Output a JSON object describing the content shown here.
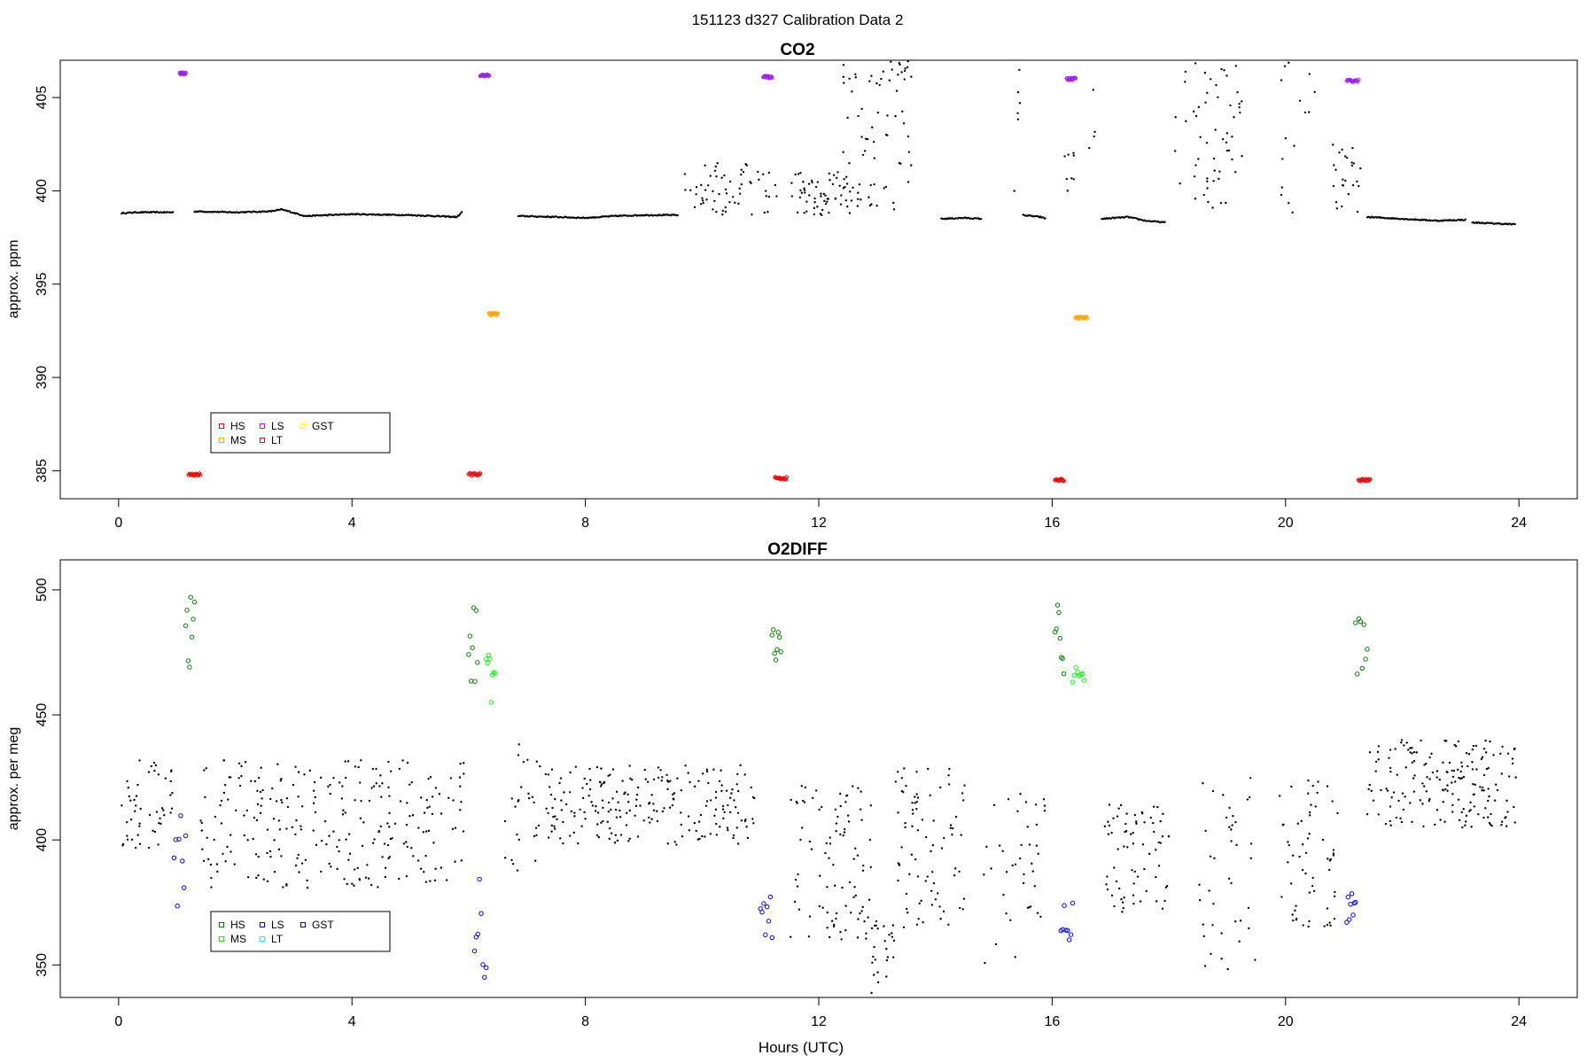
{
  "suptitle": "151123   d327   Calibration Data 2",
  "xlabel": "Hours (UTC)",
  "chart_data": [
    {
      "type": "scatter",
      "title": "CO2",
      "ylabel": "approx. ppm",
      "xlim": [
        -1,
        25
      ],
      "ylim": [
        383.5,
        407
      ],
      "xticks": [
        0,
        4,
        8,
        12,
        16,
        20,
        24
      ],
      "yticks": [
        385,
        390,
        395,
        400,
        405
      ],
      "legend": {
        "position": "bottom-left",
        "entries": [
          {
            "label": "HS",
            "color": "#ff0000"
          },
          {
            "label": "MS",
            "color": "#ffa500"
          },
          {
            "label": "LS",
            "color": "#a020f0"
          },
          {
            "label": "LT",
            "color": "#b22222"
          },
          {
            "label": "GST",
            "color": "#ffff00"
          }
        ]
      },
      "sample_series": {
        "name": "sample",
        "color": "#000000",
        "segments": [
          {
            "x": [
              0.05,
              0.3,
              0.6,
              0.95
            ],
            "y": [
              398.8,
              398.85,
              398.85,
              398.85
            ]
          },
          {
            "x": [
              1.3,
              2.0,
              2.6,
              2.8,
              3.2,
              4.0,
              5.0,
              5.8,
              5.9
            ],
            "y": [
              398.9,
              398.85,
              398.9,
              399.0,
              398.65,
              398.75,
              398.7,
              398.6,
              398.9
            ]
          },
          {
            "x": [
              6.85,
              7.5,
              8.0,
              8.5,
              9.0,
              9.6
            ],
            "y": [
              398.65,
              398.6,
              398.55,
              398.65,
              398.7,
              398.7
            ]
          },
          {
            "x": [
              14.1,
              14.5,
              14.8
            ],
            "y": [
              398.5,
              398.55,
              398.5
            ]
          },
          {
            "x": [
              15.5,
              15.8,
              15.9
            ],
            "y": [
              398.7,
              398.6,
              398.5
            ]
          },
          {
            "x": [
              16.85,
              17.3,
              17.6,
              17.95
            ],
            "y": [
              398.5,
              398.6,
              398.4,
              398.3
            ]
          },
          {
            "x": [
              21.4,
              22.0,
              22.6,
              23.1
            ],
            "y": [
              398.6,
              398.5,
              398.4,
              398.45
            ]
          },
          {
            "x": [
              23.2,
              23.6,
              23.95
            ],
            "y": [
              398.3,
              398.25,
              398.2
            ]
          }
        ],
        "scatter_clusters": [
          {
            "x": [
              9.7,
              11.3
            ],
            "y": [
              398.7,
              401.5
            ],
            "n": 60
          },
          {
            "x": [
              11.5,
              12.6
            ],
            "y": [
              398.7,
              401.0
            ],
            "n": 60
          },
          {
            "x": [
              12.4,
              13.6
            ],
            "y": [
              399.0,
              407.0
            ],
            "n": 70
          },
          {
            "x": [
              15.3,
              15.5
            ],
            "y": [
              398.5,
              406.5
            ],
            "n": 6
          },
          {
            "x": [
              16.2,
              16.4
            ],
            "y": [
              398.7,
              402.5
            ],
            "n": 8
          },
          {
            "x": [
              16.6,
              16.75
            ],
            "y": [
              402.0,
              406.0
            ],
            "n": 4
          },
          {
            "x": [
              18.0,
              18.3
            ],
            "y": [
              400.0,
              406.8
            ],
            "n": 6
          },
          {
            "x": [
              18.4,
              19.3
            ],
            "y": [
              399.0,
              406.9
            ],
            "n": 50
          },
          {
            "x": [
              19.9,
              20.5
            ],
            "y": [
              398.8,
              407.0
            ],
            "n": 15
          },
          {
            "x": [
              20.8,
              21.3
            ],
            "y": [
              398.8,
              402.8
            ],
            "n": 25
          }
        ]
      },
      "calibration_groups": [
        {
          "label": "LS",
          "color": "#a020f0",
          "x": [
            1.05,
            1.15
          ],
          "y": 406.3
        },
        {
          "label": "HS",
          "color": "#ff0000",
          "x": [
            1.2,
            1.4
          ],
          "y": 384.8
        },
        {
          "label": "HS",
          "color": "#ff0000",
          "x": [
            6.0,
            6.2
          ],
          "y": 384.8
        },
        {
          "label": "LS",
          "color": "#a020f0",
          "x": [
            6.2,
            6.35
          ],
          "y": 406.2
        },
        {
          "label": "MS",
          "color": "#ffa500",
          "x": [
            6.35,
            6.5
          ],
          "y": 393.4
        },
        {
          "label": "LS",
          "color": "#a020f0",
          "x": [
            11.05,
            11.2
          ],
          "y": 406.1
        },
        {
          "label": "HS",
          "color": "#ff0000",
          "x": [
            11.25,
            11.45
          ],
          "y": 384.6
        },
        {
          "label": "HS",
          "color": "#ff0000",
          "x": [
            16.05,
            16.2
          ],
          "y": 384.5
        },
        {
          "label": "LS",
          "color": "#a020f0",
          "x": [
            16.25,
            16.4
          ],
          "y": 406.0
        },
        {
          "label": "MS",
          "color": "#ffa500",
          "x": [
            16.4,
            16.6
          ],
          "y": 393.2
        },
        {
          "label": "LS",
          "color": "#a020f0",
          "x": [
            21.05,
            21.25
          ],
          "y": 405.9
        },
        {
          "label": "HS",
          "color": "#ff0000",
          "x": [
            21.25,
            21.45
          ],
          "y": 384.5
        }
      ]
    },
    {
      "type": "scatter",
      "title": "O2DIFF",
      "ylabel": "approx. per meg",
      "xlim": [
        -1,
        25
      ],
      "ylim": [
        337,
        512
      ],
      "xticks": [
        0,
        4,
        8,
        12,
        16,
        20,
        24
      ],
      "yticks": [
        350,
        400,
        450,
        500
      ],
      "legend": {
        "position": "bottom-left",
        "entries": [
          {
            "label": "HS",
            "color": "#008000"
          },
          {
            "label": "MS",
            "color": "#00ff00"
          },
          {
            "label": "LS",
            "color": "#0000ff"
          },
          {
            "label": "LT",
            "color": "#00ffff"
          },
          {
            "label": "GST",
            "color": "#0000cd"
          }
        ]
      },
      "sample_series": {
        "name": "sample",
        "color": "#000000",
        "scatter_clusters": [
          {
            "x": [
              0.05,
              0.95
            ],
            "y": [
              395,
              432
            ],
            "n": 50
          },
          {
            "x": [
              1.4,
              6.0
            ],
            "y": [
              380,
              432
            ],
            "n": 260
          },
          {
            "x": [
              6.6,
              7.2
            ],
            "y": [
              385,
              440
            ],
            "n": 25
          },
          {
            "x": [
              7.2,
              10.9
            ],
            "y": [
              398,
              430
            ],
            "n": 220
          },
          {
            "x": [
              11.5,
              12.9
            ],
            "y": [
              360,
              422
            ],
            "n": 90
          },
          {
            "x": [
              12.9,
              13.3
            ],
            "y": [
              338,
              370
            ],
            "n": 25
          },
          {
            "x": [
              13.3,
              14.5
            ],
            "y": [
              365,
              430
            ],
            "n": 80
          },
          {
            "x": [
              14.8,
              15.9
            ],
            "y": [
              350,
              420
            ],
            "n": 40
          },
          {
            "x": [
              16.9,
              18.0
            ],
            "y": [
              370,
              415
            ],
            "n": 70
          },
          {
            "x": [
              18.5,
              19.5
            ],
            "y": [
              345,
              425
            ],
            "n": 40
          },
          {
            "x": [
              19.9,
              20.9
            ],
            "y": [
              365,
              425
            ],
            "n": 60
          },
          {
            "x": [
              21.4,
              23.95
            ],
            "y": [
              405,
              440
            ],
            "n": 180
          }
        ]
      },
      "calibration_groups": [
        {
          "label": "LS",
          "color": "#0000ff",
          "x": [
            0.95,
            1.15
          ],
          "y": [
            370,
            410
          ]
        },
        {
          "label": "HS",
          "color": "#008000",
          "x": [
            1.15,
            1.3
          ],
          "y": [
            458,
            505
          ]
        },
        {
          "label": "HS",
          "color": "#008000",
          "x": [
            6.0,
            6.15
          ],
          "y": [
            458,
            502
          ]
        },
        {
          "label": "LS",
          "color": "#0000ff",
          "x": [
            6.1,
            6.3
          ],
          "y": [
            344,
            385
          ]
        },
        {
          "label": "MS",
          "color": "#00ff00",
          "x": [
            6.3,
            6.45
          ],
          "y": [
            455,
            483
          ]
        },
        {
          "label": "LS",
          "color": "#0000ff",
          "x": [
            11.0,
            11.2
          ],
          "y": [
            358,
            380
          ]
        },
        {
          "label": "HS",
          "color": "#008000",
          "x": [
            11.2,
            11.35
          ],
          "y": [
            471,
            490
          ]
        },
        {
          "label": "HS",
          "color": "#008000",
          "x": [
            16.05,
            16.2
          ],
          "y": [
            450,
            494
          ]
        },
        {
          "label": "LS",
          "color": "#0000ff",
          "x": [
            16.15,
            16.35
          ],
          "y": [
            358,
            375
          ]
        },
        {
          "label": "MS",
          "color": "#00ff00",
          "x": [
            16.35,
            16.55
          ],
          "y": [
            463,
            470
          ]
        },
        {
          "label": "LS",
          "color": "#0000ff",
          "x": [
            21.05,
            21.2
          ],
          "y": [
            360,
            382
          ]
        },
        {
          "label": "HS",
          "color": "#008000",
          "x": [
            21.2,
            21.4
          ],
          "y": [
            465,
            494
          ]
        }
      ]
    }
  ]
}
